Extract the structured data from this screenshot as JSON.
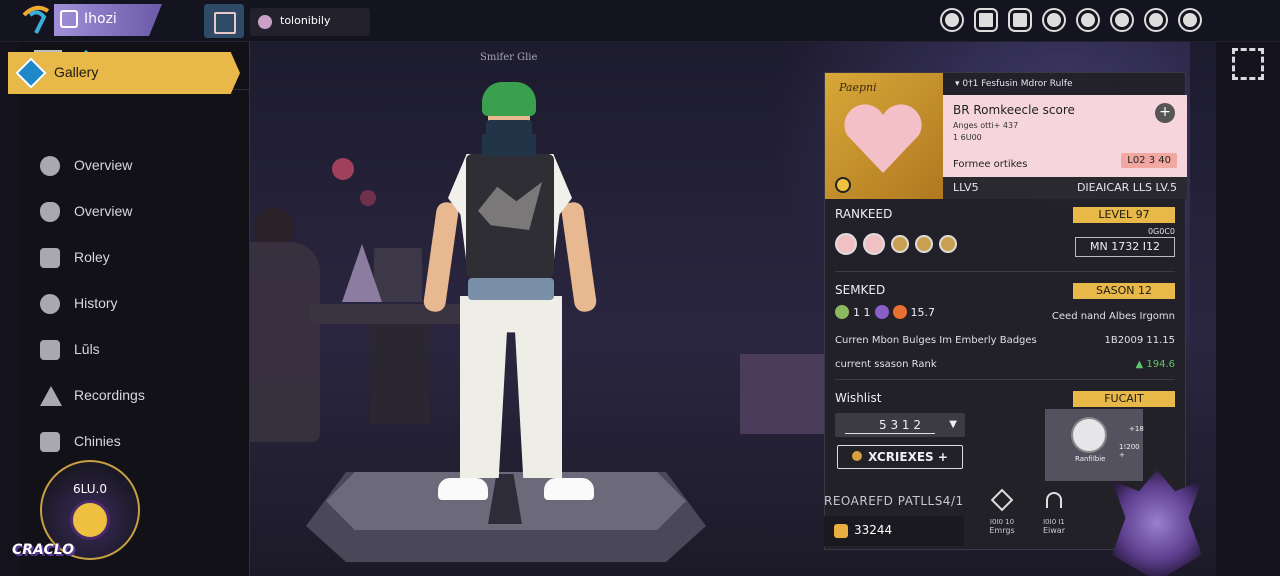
{
  "topbar": {
    "app_tab_label": "Ihozi",
    "search_label": "tolonibily"
  },
  "sidebar": {
    "active_label": "Gallery",
    "items": [
      {
        "label": "Overview",
        "icon": "face-icon"
      },
      {
        "label": "Overview",
        "icon": "beard-icon"
      },
      {
        "label": "Roley",
        "icon": "person-icon"
      },
      {
        "label": "History",
        "icon": "lock-icon"
      },
      {
        "label": "Lŭls",
        "icon": "mail-icon"
      },
      {
        "label": "Recordings",
        "icon": "tent-icon"
      },
      {
        "label": "Chinies",
        "icon": "frame-icon"
      }
    ],
    "user_badge_text": "6LU.0",
    "user_name": "CRACLO"
  },
  "scene": {
    "label": "Smifer  Glie"
  },
  "panel": {
    "card": {
      "art_caption": "Paepni",
      "header": "▾ 0†1 Fesfusin Mdror Rulfe",
      "title": "BR Romkeecle score",
      "sub1": "Anges otti+  437",
      "sub2": "1 6U00",
      "footer": "Formee ortikes",
      "tag": "L02 3  40",
      "meta_left": "LLV5",
      "meta_right": "DIEAICAR LLS LV.5"
    },
    "ranked": {
      "title": "RANKEED",
      "pill": "LEVEL 97",
      "small": "0G0C0",
      "stat": "MN   1732   I12"
    },
    "smkd": {
      "title": "SEMKED",
      "pill": "SASON 12",
      "icon_text": "1 1",
      "value": "15.7",
      "right_text": "Ceed nand Albes Irgomn",
      "row2_left": "Curren Mbon Bulges Im Emberly Badges",
      "row2_right": "1B2009  11.15",
      "row3_left": "current ssason Rank",
      "row3_right": "▲ 194.6"
    },
    "wishlist": {
      "title": "Wishlist",
      "pill": "FUCAIT",
      "select_value": "5 3 1 2",
      "button_label": "XCRIEXES  +",
      "item_label": "Ranfilbie",
      "item_n1": "+18",
      "item_n2": "1!200 +"
    }
  },
  "bottom": {
    "heading": "REOAREFD PATLLS4/1",
    "coins": "33244",
    "mini1_t1": "I0I0 10",
    "mini1_t2": "Emrgs",
    "mini2_t1": "I0I0 I1",
    "mini2_t2": "Eiwar"
  }
}
